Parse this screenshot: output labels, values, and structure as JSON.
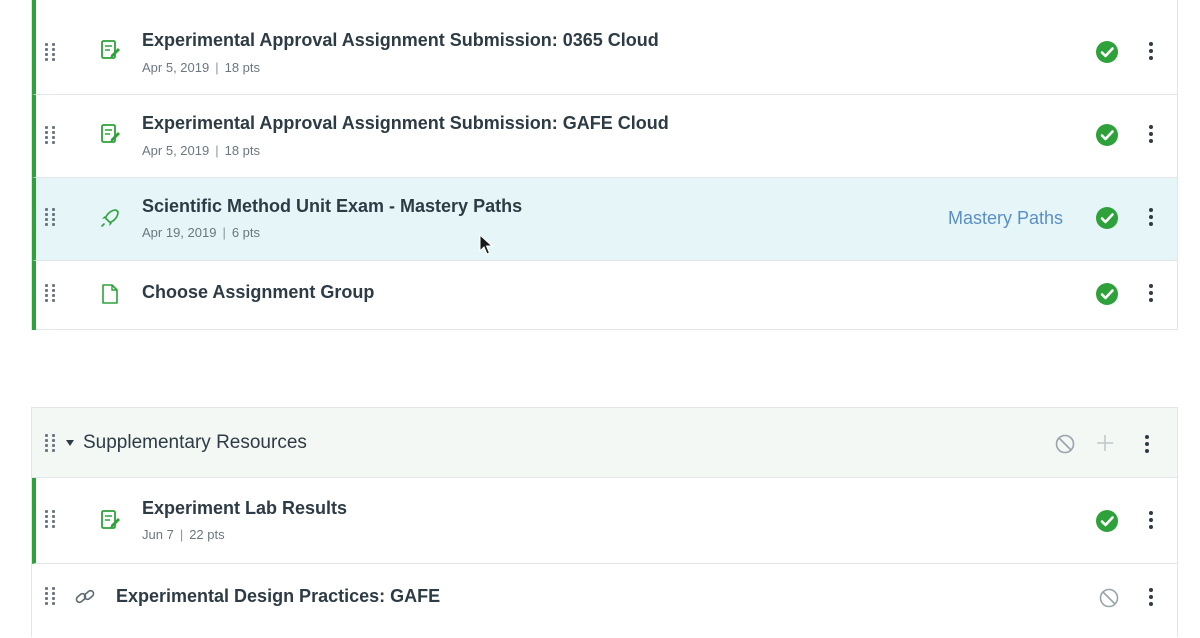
{
  "module_1": {
    "items": [
      {
        "title": "Experimental Approval Assignment Submission: 0365 Cloud",
        "date": "Apr 5, 2019",
        "points": "18 pts",
        "icon": "assignment-icon",
        "status": "published"
      },
      {
        "title": "Experimental Approval Assignment Submission: GAFE Cloud",
        "date": "Apr 5, 2019",
        "points": "18 pts",
        "icon": "assignment-icon",
        "status": "published"
      },
      {
        "title": "Scientific Method Unit Exam - Mastery Paths",
        "date": "Apr 19, 2019",
        "points": "6 pts",
        "icon": "quiz-rocket-icon",
        "status": "published",
        "link_label": "Mastery Paths"
      },
      {
        "title": "Choose Assignment Group",
        "icon": "page-icon",
        "status": "published"
      }
    ]
  },
  "module_2": {
    "title": "Supplementary Resources",
    "header_icons": [
      "unpublished-circle-icon",
      "plus-icon",
      "kebab-icon"
    ],
    "items": [
      {
        "title": "Experiment Lab Results",
        "date": "Jun 7",
        "points": "22 pts",
        "icon": "assignment-icon",
        "status": "published"
      },
      {
        "title": "Experimental Design Practices: GAFE",
        "icon": "link-icon",
        "status": "unpublished"
      }
    ]
  },
  "colors": {
    "published_green": "#2ea13a",
    "link_blue": "#5b8fc4",
    "highlight_row": "#e6f5f8",
    "module_header_bg": "#f4f8f5",
    "text_dark": "#2d3b45",
    "text_muted": "#6b7780"
  }
}
